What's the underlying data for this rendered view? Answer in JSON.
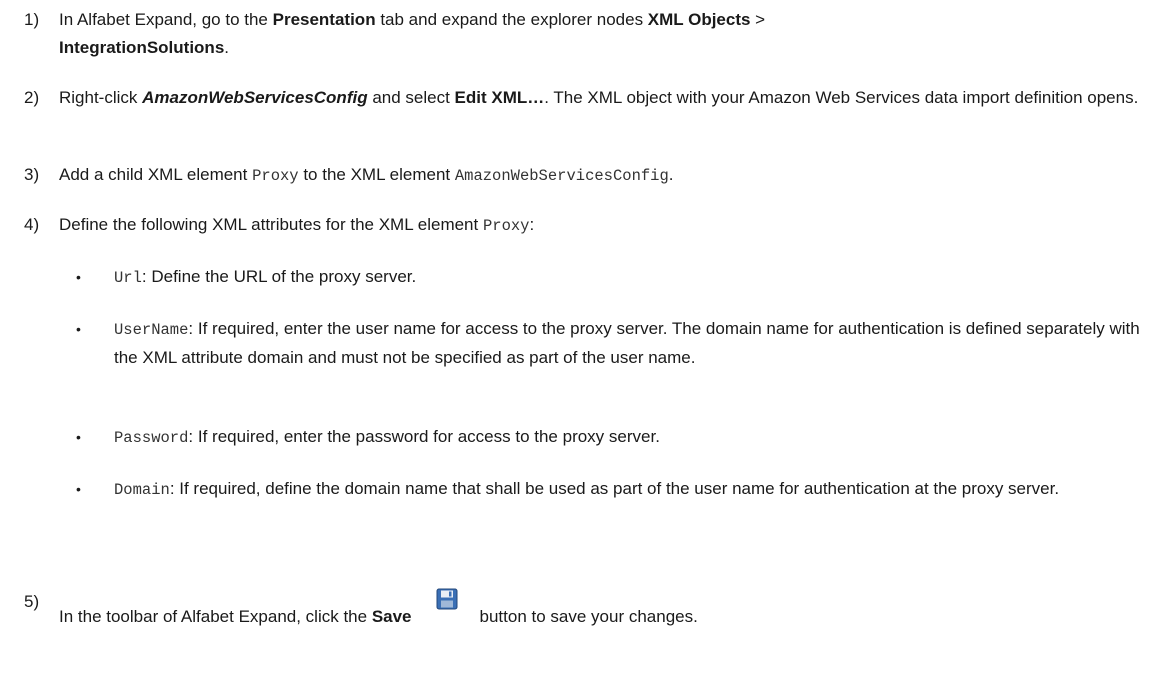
{
  "steps": [
    {
      "num": "1)",
      "parts": [
        "In Alfabet Expand, go to the ",
        "Presentation",
        " tab and expand the explorer nodes ",
        "XML Objects",
        " > ",
        "IntegrationSolutions",
        "."
      ]
    },
    {
      "num": "2)",
      "parts": [
        "Right-click ",
        "AmazonWebServicesConfig",
        " and select ",
        "Edit XML…",
        ". The XML object with your Amazon Web Services data import definition opens."
      ]
    },
    {
      "num": "3)",
      "parts": [
        "Add a child XML element ",
        "Proxy",
        " to the XML element ",
        "AmazonWebServicesConfig",
        "."
      ]
    },
    {
      "num": "4)",
      "parts": [
        "Define the following XML attributes for the XML element ",
        "Proxy",
        ":"
      ]
    },
    {
      "num": "5)",
      "parts": [
        "In the toolbar of Alfabet Expand, click the ",
        "Save",
        "button to save your changes."
      ]
    }
  ],
  "bullets": [
    {
      "dot": "•",
      "code": "Url",
      "text": ": Define the URL of the proxy server."
    },
    {
      "dot": "•",
      "code": "UserName",
      "text": ": If required, enter the user name for access to the proxy server. The domain name for authentication is defined separately with the XML attribute domain and must not be specified as part of the user name."
    },
    {
      "dot": "•",
      "code": "Password",
      "text": ": If required, enter the password for access to the proxy server."
    },
    {
      "dot": "•",
      "code": "Domain",
      "text": ": If required, define the domain name that shall be used as part of the user name for authentication at the proxy server."
    }
  ],
  "icons": {
    "save": "save-floppy-icon",
    "save_color": "#3a6fb5"
  }
}
